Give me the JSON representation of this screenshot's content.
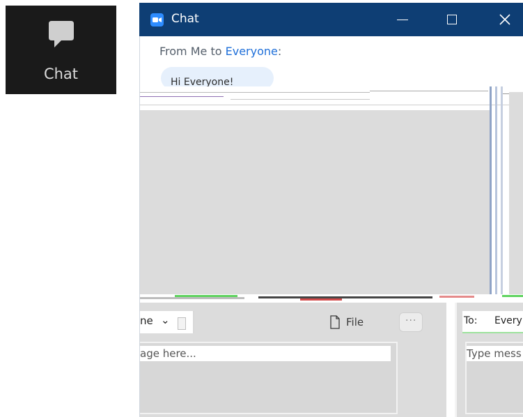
{
  "toolbar": {
    "chat_label": "Chat",
    "chat_icon": "chat-bubble-icon"
  },
  "window": {
    "title": "Chat",
    "app_icon": "zoom-camera-icon",
    "controls": {
      "minimize": "minimize-icon",
      "maximize": "maximize-icon",
      "close": "close-icon"
    }
  },
  "messages": [
    {
      "from_prefix": "From Me to ",
      "recipient": "Everyone",
      "suffix": ":",
      "text": "Hi Everyone!"
    }
  ],
  "composer": {
    "to_value_left": "ne",
    "file_label": "File",
    "more_label": "···",
    "placeholder_left": "age here...",
    "to_label_right": "To:",
    "to_value_right": "Every",
    "placeholder_right": "Type mess"
  },
  "colors": {
    "title_bar": "#0e3e74",
    "accent": "#2d8cff",
    "link": "#1e6fd9",
    "bubble": "#e6f0fc",
    "glitch_grey": "#dcdcdc"
  }
}
